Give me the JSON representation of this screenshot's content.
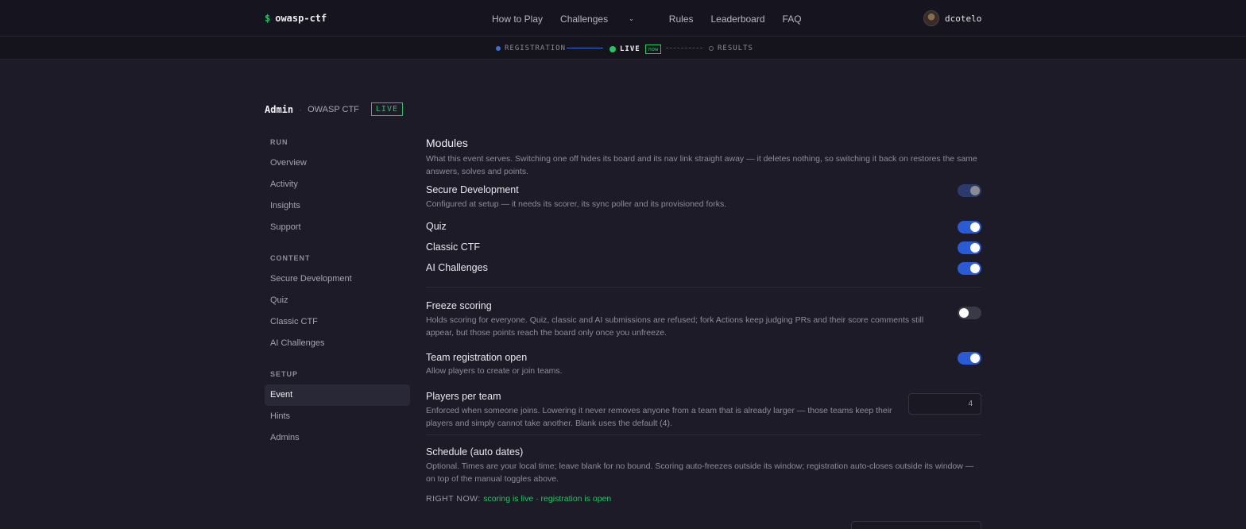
{
  "brand": {
    "prompt": "$",
    "name": "owasp-ctf"
  },
  "nav": {
    "how_to_play": "How to Play",
    "challenges": "Challenges",
    "rules": "Rules",
    "leaderboard": "Leaderboard",
    "faq": "FAQ"
  },
  "user": {
    "name": "dcotelo"
  },
  "phases": {
    "registration": "REGISTRATION",
    "live": "LIVE",
    "now_badge": "now",
    "results": "RESULTS"
  },
  "breadcrumb": {
    "section": "Admin",
    "separator": "·",
    "event": "OWASP CTF",
    "status": "LIVE"
  },
  "sidebar": {
    "run_title": "RUN",
    "run_items": [
      "Overview",
      "Activity",
      "Insights",
      "Support"
    ],
    "content_title": "CONTENT",
    "content_items": [
      "Secure Development",
      "Quiz",
      "Classic CTF",
      "AI Challenges"
    ],
    "setup_title": "SETUP",
    "setup_items": [
      "Event",
      "Hints",
      "Admins"
    ],
    "active": "Event"
  },
  "modules": {
    "title": "Modules",
    "description": "What this event serves. Switching one off hides its board and its nav link straight away — it deletes nothing, so switching it back on restores the same answers, solves and points.",
    "items": [
      {
        "label": "Secure Development",
        "note": "Configured at setup — it needs its scorer, its sync poller and its provisioned forks.",
        "state": "locked-on"
      },
      {
        "label": "Quiz",
        "state": "on"
      },
      {
        "label": "Classic CTF",
        "state": "on"
      },
      {
        "label": "AI Challenges",
        "state": "on"
      }
    ]
  },
  "freeze": {
    "title": "Freeze scoring",
    "description": "Holds scoring for everyone. Quiz, classic and AI submissions are refused; fork Actions keep judging PRs and their score comments still appear, but those points reach the board only once you unfreeze.",
    "state": "off"
  },
  "team_registration": {
    "title": "Team registration open",
    "description": "Allow players to create or join teams.",
    "state": "on"
  },
  "players_per_team": {
    "title": "Players per team",
    "description": "Enforced when someone joins. Lowering it never removes anyone from a team that is already larger — those teams keep their players and simply cannot take another. Blank uses the default (4).",
    "placeholder": "4"
  },
  "schedule": {
    "title": "Schedule (auto dates)",
    "description": "Optional. Times are your local time; leave blank for no bound. Scoring auto-freezes outside its window; registration auto-closes outside its window — on top of the manual toggles above.",
    "right_now_label": "RIGHT NOW:",
    "right_now_value": "scoring is live · registration is open"
  },
  "colors": {
    "accent": "#2a5bd7",
    "live_green": "#22c55e",
    "background": "#1c1b27"
  }
}
